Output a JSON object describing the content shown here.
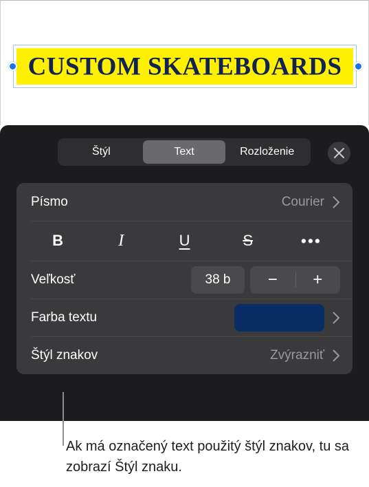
{
  "canvas": {
    "textbox": {
      "headline": "CUSTOM SKATEBOARDS",
      "fill_color": "#ffef00",
      "text_color": "#112254",
      "handle_color": "#1e74e8",
      "selection_border_color": "#a8c3ea"
    }
  },
  "panel": {
    "tabs": [
      {
        "label": "Štýl",
        "selected": false
      },
      {
        "label": "Text",
        "selected": true
      },
      {
        "label": "Rozloženie",
        "selected": false
      }
    ],
    "close_icon": "close-icon",
    "rows": {
      "font": {
        "label": "Písmo",
        "value": "Courier"
      },
      "format": {
        "bold": "B",
        "italic": "I",
        "underline": "U",
        "strikethrough": "S",
        "more": "•••"
      },
      "size": {
        "label": "Veľkosť",
        "value": "38 b",
        "decrement": "−",
        "increment": "+"
      },
      "text_color": {
        "label": "Farba textu",
        "value_color": "#0b2d66"
      },
      "character_style": {
        "label": "Štýl znakov",
        "value": "Zvýrazniť"
      }
    }
  },
  "caption": {
    "text": "Ak má označený text použitý štýl znakov, tu sa zobrazí Štýl znaku."
  }
}
